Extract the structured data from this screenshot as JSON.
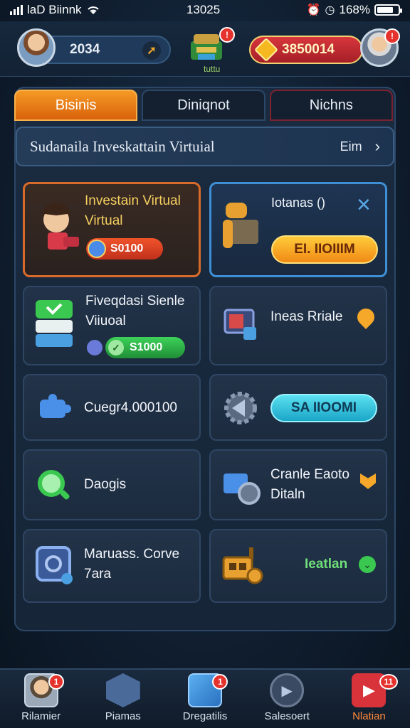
{
  "status_bar": {
    "carrier": "laD Biinnk",
    "time": "13025",
    "battery": "168%"
  },
  "hud": {
    "left_value": "2034",
    "right_value": "3850014",
    "chest_label": "tuttu",
    "chest_badge": "",
    "avatar_badge": ""
  },
  "tabs": [
    "Bisinis",
    "Diniqnot",
    "Nichns"
  ],
  "title_bar": {
    "title": "Sudanaila Inveskattain Virtuial",
    "more": "Eim"
  },
  "cards": [
    {
      "line1": "Investain Virtual",
      "line2": "Virtual",
      "coin": "S0100"
    },
    {
      "line1": "Iotanas ()",
      "action": "EI. IIOIIIM"
    },
    {
      "line1": "Fiveqdasi Sienle",
      "line2": "Viiuoal",
      "coin": "S1000"
    },
    {
      "line1": "Ineas Rriale"
    },
    {
      "line1": "Cuegr4.000100"
    },
    {
      "action": "SA IIOOMI"
    },
    {
      "line1": "Daogis"
    },
    {
      "line1": "Cranle Eaoto",
      "line2": "Ditaln"
    },
    {
      "line1": "Maruass. Corve",
      "line2": "7ara"
    },
    {
      "line1": "Ieatlan"
    }
  ],
  "bottom_nav": [
    {
      "label": "Rilamier",
      "badge": "1"
    },
    {
      "label": "Piamas",
      "badge": ""
    },
    {
      "label": "Dregatilis",
      "badge": "1"
    },
    {
      "label": "Salesoert",
      "badge": ""
    },
    {
      "label": "Nlatian",
      "badge": "11"
    }
  ],
  "colors": {
    "accent": "#f59a25",
    "gold": "#f5d060",
    "green": "#6fe07a",
    "blue": "#3f8fd6"
  }
}
